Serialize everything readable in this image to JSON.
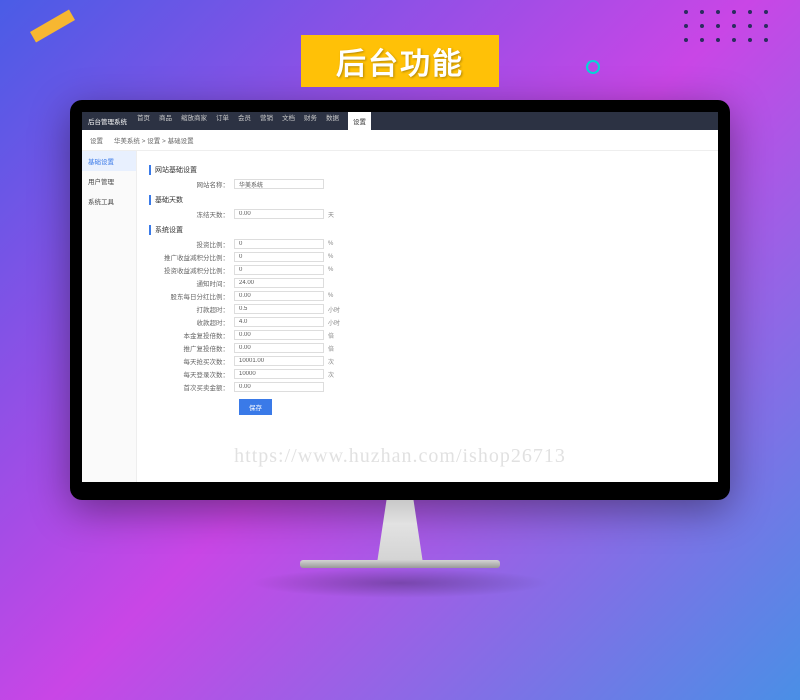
{
  "banner_title": "后台功能",
  "watermark": "https://www.huzhan.com/ishop26713",
  "topbar": {
    "brand": "后台管理系统",
    "nav": [
      "首页",
      "商品",
      "缩放商家",
      "订单",
      "会员",
      "营销",
      "文档",
      "财务",
      "数据",
      "设置"
    ],
    "active_index": 9
  },
  "breadcrumb": {
    "root": "设置",
    "path": "华美系统 > 设置 > 基础设置"
  },
  "sidebar": {
    "items": [
      "基础设置",
      "用户管理",
      "系统工具"
    ],
    "active_index": 0
  },
  "sections": [
    {
      "title": "网站基础设置",
      "rows": [
        {
          "label": "网站名称：",
          "value": "华美系统",
          "unit": ""
        }
      ]
    },
    {
      "title": "基础天数",
      "rows": [
        {
          "label": "冻结天数：",
          "value": "0.00",
          "unit": "天"
        }
      ]
    },
    {
      "title": "系统设置",
      "rows": [
        {
          "label": "投资比例：",
          "value": "0",
          "unit": "%"
        },
        {
          "label": "推广收益减积分比例：",
          "value": "0",
          "unit": "%"
        },
        {
          "label": "投资收益减积分比例：",
          "value": "0",
          "unit": "%"
        },
        {
          "label": "通知时间：",
          "value": "24.00",
          "unit": ""
        },
        {
          "label": "股东每日分红比例：",
          "value": "0.00",
          "unit": "%"
        },
        {
          "label": "打款超时：",
          "value": "0.5",
          "unit": "小时"
        },
        {
          "label": "收款超时：",
          "value": "4.0",
          "unit": "小时"
        },
        {
          "label": "本金复投倍数：",
          "value": "0.00",
          "unit": "倍"
        },
        {
          "label": "推广复投倍数：",
          "value": "0.00",
          "unit": "倍"
        },
        {
          "label": "每天抢买次数：",
          "value": "10001.00",
          "unit": "次"
        },
        {
          "label": "每天登录次数：",
          "value": "10000",
          "unit": "次"
        },
        {
          "label": "首次买卖金额：",
          "value": "0.00",
          "unit": ""
        }
      ]
    }
  ],
  "save_label": "保存"
}
